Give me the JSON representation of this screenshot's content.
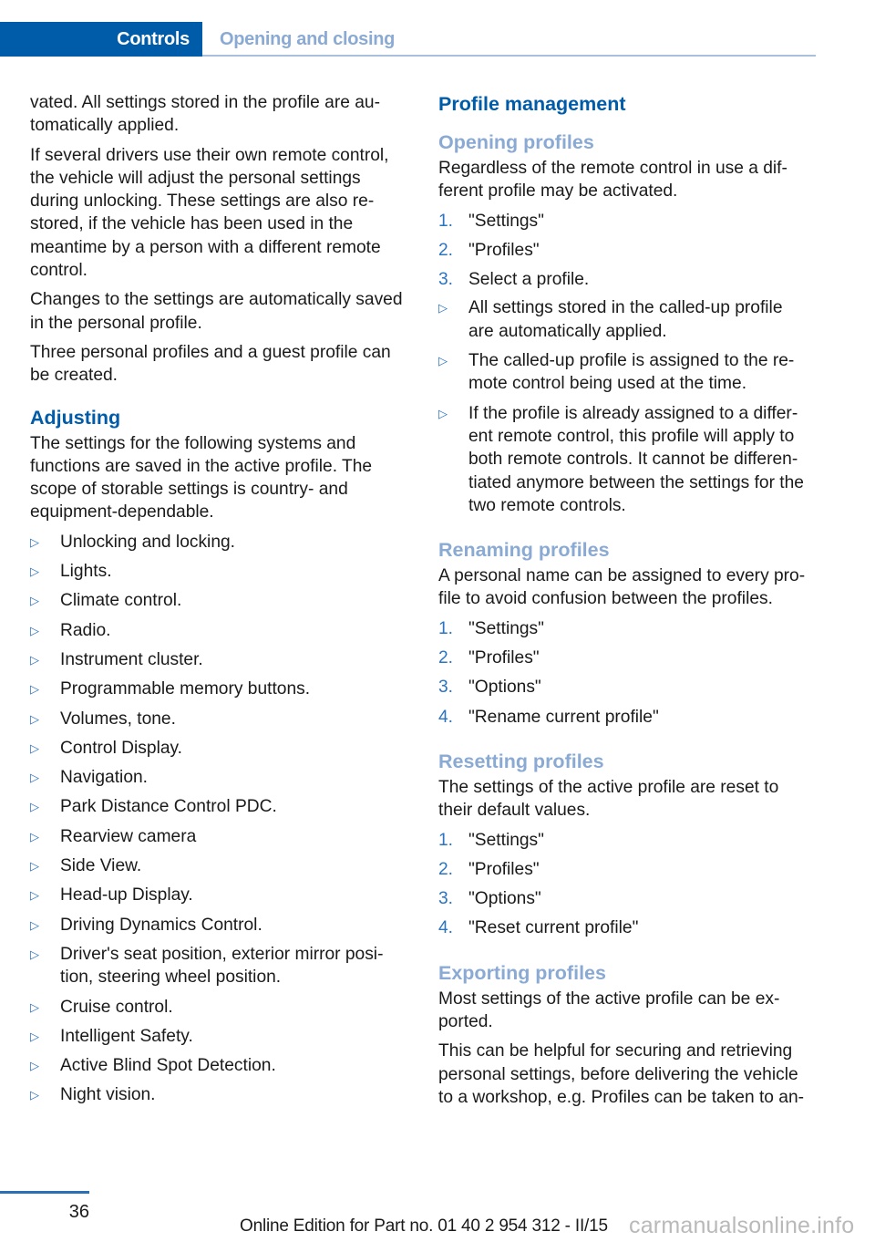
{
  "header": {
    "chapter": "Controls",
    "section": "Opening and closing",
    "accent_color": "#005ba8",
    "section_color": "#8aaad4"
  },
  "left": {
    "paragraphs_intro": [
      "vated. All settings stored in the profile are au­tomatically applied.",
      "If several drivers use their own remote control, the vehicle will adjust the personal settings during unlocking. These settings are also re­stored, if the vehicle has been used in the meantime by a person with a different remote control.",
      "Changes to the settings are automatically saved in the personal profile.",
      "Three personal profiles and a guest profile can be created."
    ],
    "adjusting": {
      "title": "Adjusting",
      "text": "The settings for the following systems and functions are saved in the active profile. The scope of storable settings is country- and equipment-dependable.",
      "bullet_icon": "triangle-right-icon",
      "items": [
        "Unlocking and locking.",
        "Lights.",
        "Climate control.",
        "Radio.",
        "Instrument cluster.",
        "Programmable memory buttons.",
        "Volumes, tone.",
        "Control Display.",
        "Navigation.",
        "Park Distance Control PDC.",
        "Rearview camera",
        "Side View.",
        "Head-up Display.",
        "Driving Dynamics Control.",
        "Driver's seat position, exterior mirror posi­tion, steering wheel position.",
        "Cruise control.",
        "Intelligent Safety.",
        "Active Blind Spot Detection.",
        "Night vision."
      ]
    }
  },
  "right": {
    "title": "Profile management",
    "opening": {
      "title": "Opening profiles",
      "text": "Regardless of the remote control in use a dif­ferent profile may be activated.",
      "steps": [
        {
          "n": "1.",
          "text": "\"Settings\""
        },
        {
          "n": "2.",
          "text": "\"Profiles\""
        },
        {
          "n": "3.",
          "text": "Select a profile."
        }
      ],
      "notes": [
        "All settings stored in the called-up profile are automatically applied.",
        "The called-up profile is assigned to the re­mote control being used at the time.",
        "If the profile is already assigned to a differ­ent remote control, this profile will apply to both remote controls. It cannot be differen­tiated anymore between the settings for the two remote controls."
      ]
    },
    "renaming": {
      "title": "Renaming profiles",
      "text": "A personal name can be assigned to every pro­file to avoid confusion between the profiles.",
      "steps": [
        {
          "n": "1.",
          "text": "\"Settings\""
        },
        {
          "n": "2.",
          "text": "\"Profiles\""
        },
        {
          "n": "3.",
          "text": "\"Options\""
        },
        {
          "n": "4.",
          "text": "\"Rename current profile\""
        }
      ]
    },
    "resetting": {
      "title": "Resetting profiles",
      "text": "The settings of the active profile are reset to their default values.",
      "steps": [
        {
          "n": "1.",
          "text": "\"Settings\""
        },
        {
          "n": "2.",
          "text": "\"Profiles\""
        },
        {
          "n": "3.",
          "text": "\"Options\""
        },
        {
          "n": "4.",
          "text": "\"Reset current profile\""
        }
      ]
    },
    "exporting": {
      "title": "Exporting profiles",
      "paragraphs": [
        "Most settings of the active profile can be ex­ported.",
        "This can be helpful for securing and retrieving personal settings, before delivering the vehicle to a workshop, e.g. Profiles can be taken to an-"
      ]
    }
  },
  "footer": {
    "page_number": "36",
    "edition": "Online Edition for Part no. 01 40 2 954 312 - II/15",
    "watermark": "carmanualsonline.info"
  }
}
